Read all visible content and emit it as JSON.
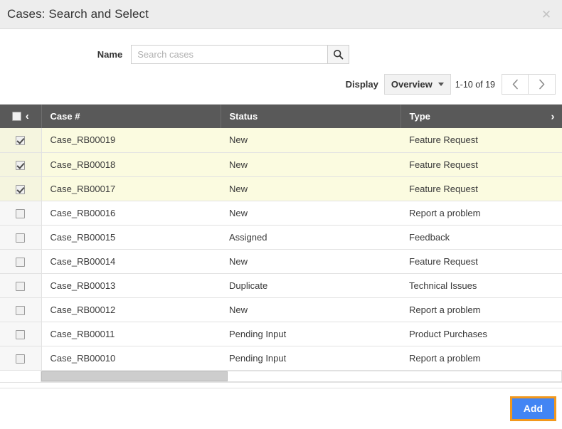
{
  "dialog": {
    "title": "Cases: Search and Select",
    "close_icon": "close-icon"
  },
  "search": {
    "label": "Name",
    "placeholder": "Search cases",
    "value": "",
    "button_icon": "search-icon"
  },
  "display": {
    "label": "Display",
    "selected": "Overview",
    "range": "1-10 of 19",
    "prev_icon": "‹",
    "next_icon": "›"
  },
  "table": {
    "select_all_checked": false,
    "header_chevron_left": "‹",
    "header_chevron_right": "›",
    "columns": [
      "Case #",
      "Status",
      "Type"
    ],
    "rows": [
      {
        "checked": true,
        "case": "Case_RB00019",
        "status": "New",
        "type": "Feature Request"
      },
      {
        "checked": true,
        "case": "Case_RB00018",
        "status": "New",
        "type": "Feature Request"
      },
      {
        "checked": true,
        "case": "Case_RB00017",
        "status": "New",
        "type": "Feature Request"
      },
      {
        "checked": false,
        "case": "Case_RB00016",
        "status": "New",
        "type": "Report a problem"
      },
      {
        "checked": false,
        "case": "Case_RB00015",
        "status": "Assigned",
        "type": "Feedback"
      },
      {
        "checked": false,
        "case": "Case_RB00014",
        "status": "New",
        "type": "Feature Request"
      },
      {
        "checked": false,
        "case": "Case_RB00013",
        "status": "Duplicate",
        "type": "Technical Issues"
      },
      {
        "checked": false,
        "case": "Case_RB00012",
        "status": "New",
        "type": "Report a problem"
      },
      {
        "checked": false,
        "case": "Case_RB00011",
        "status": "Pending Input",
        "type": "Product Purchases"
      },
      {
        "checked": false,
        "case": "Case_RB00010",
        "status": "Pending Input",
        "type": "Report a problem"
      }
    ]
  },
  "footer": {
    "add_label": "Add"
  },
  "colors": {
    "header_bg": "#595959",
    "selected_row": "#fbfbe0",
    "accent_button": "#4285f4",
    "focus_outline": "#f2981d"
  }
}
